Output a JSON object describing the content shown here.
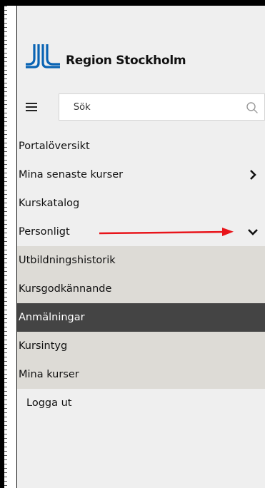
{
  "brand": {
    "name": "Region Stockholm",
    "accent_color": "#0a64b4"
  },
  "search": {
    "placeholder": "Sök",
    "icon": "search-icon"
  },
  "menu_button": {
    "icon": "hamburger-menu-icon"
  },
  "nav": {
    "items": [
      {
        "label": "Portalöversikt"
      },
      {
        "label": "Mina senaste kurser",
        "icon": "chevron-right-icon"
      },
      {
        "label": "Kurskatalog"
      },
      {
        "label": "Personligt",
        "icon": "chevron-down-icon",
        "expanded": true
      }
    ],
    "subitems": [
      {
        "label": "Utbildningshistorik"
      },
      {
        "label": "Kursgodkännande"
      },
      {
        "label": "Anmälningar",
        "active": true
      },
      {
        "label": "Kursintyg"
      },
      {
        "label": "Mina kurser"
      }
    ],
    "logout": {
      "label": "Logga ut"
    }
  },
  "colors": {
    "sidebar_bg": "#efefef",
    "submenu_bg": "#dddbd6",
    "active_bg": "#444444",
    "annotation_arrow": "#e8141a"
  }
}
